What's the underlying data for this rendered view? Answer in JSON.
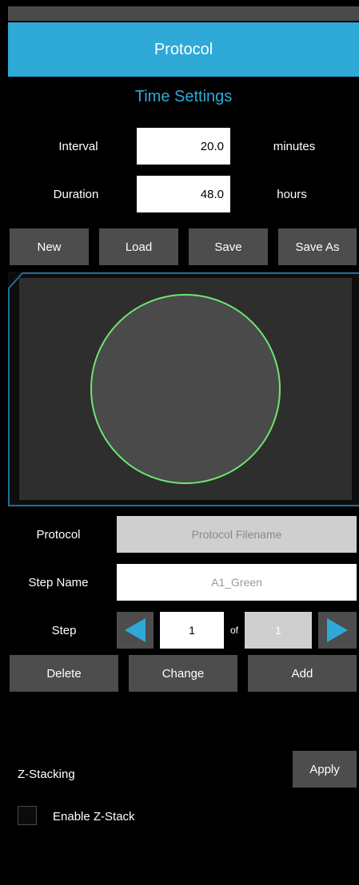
{
  "header": {
    "title": "Protocol"
  },
  "time_settings": {
    "title": "Time Settings",
    "interval_label": "Interval",
    "interval_value": "20.0",
    "interval_unit": "minutes",
    "duration_label": "Duration",
    "duration_value": "48.0",
    "duration_unit": "hours"
  },
  "file_buttons": {
    "new": "New",
    "load": "Load",
    "save": "Save",
    "save_as": "Save As"
  },
  "protocol": {
    "label": "Protocol",
    "filename_placeholder": "Protocol Filename",
    "step_name_label": "Step Name",
    "step_name_value": "A1_Green",
    "step_label": "Step",
    "step_current": "1",
    "step_of": "of",
    "step_total": "1"
  },
  "step_buttons": {
    "delete": "Delete",
    "change": "Change",
    "add": "Add"
  },
  "zstack": {
    "label": "Z-Stacking",
    "apply": "Apply",
    "enable_label": "Enable Z-Stack",
    "enabled": false
  },
  "colors": {
    "accent": "#2ea9d8",
    "button": "#4d4d4d",
    "circle": "#6ee66e",
    "arrow": "#2ea9d8"
  }
}
